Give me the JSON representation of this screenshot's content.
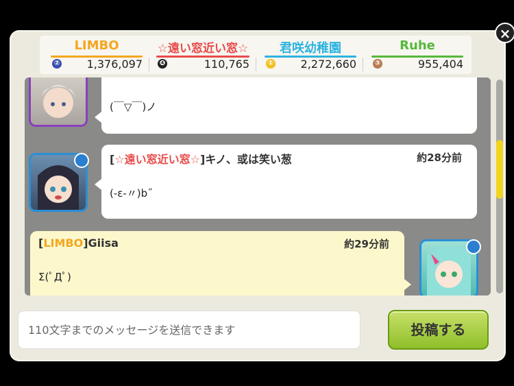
{
  "header": {
    "teams": [
      {
        "name": "LIMBO",
        "rank": "②",
        "score": "1,376,097",
        "color": "#f4a61e"
      },
      {
        "name": "☆遠い窓近い窓☆",
        "rank": "❹",
        "score": "110,765",
        "color": "#e84a4a"
      },
      {
        "name": "君咲幼稚園",
        "rank": "①",
        "score": "2,272,660",
        "color": "#2cb3e0"
      },
      {
        "name": "Ruhe",
        "rank": "③",
        "score": "955,404",
        "color": "#55b83a"
      }
    ]
  },
  "messages": [
    {
      "body": "(￣▽￣)ノ"
    },
    {
      "team": "☆遠い窓近い窓☆",
      "author": "キノ、或は笑い葱",
      "time": "約28分前",
      "body": "(-ε-〃)b˝"
    },
    {
      "team": "LIMBO",
      "author": "Giisa",
      "time": "約29分前",
      "body": "Σ(ﾟДﾟ)"
    }
  ],
  "input": {
    "placeholder": "110文字までのメッセージを送信できます"
  },
  "post_button": {
    "label": "投稿する"
  },
  "close_button": {
    "label": "×"
  }
}
